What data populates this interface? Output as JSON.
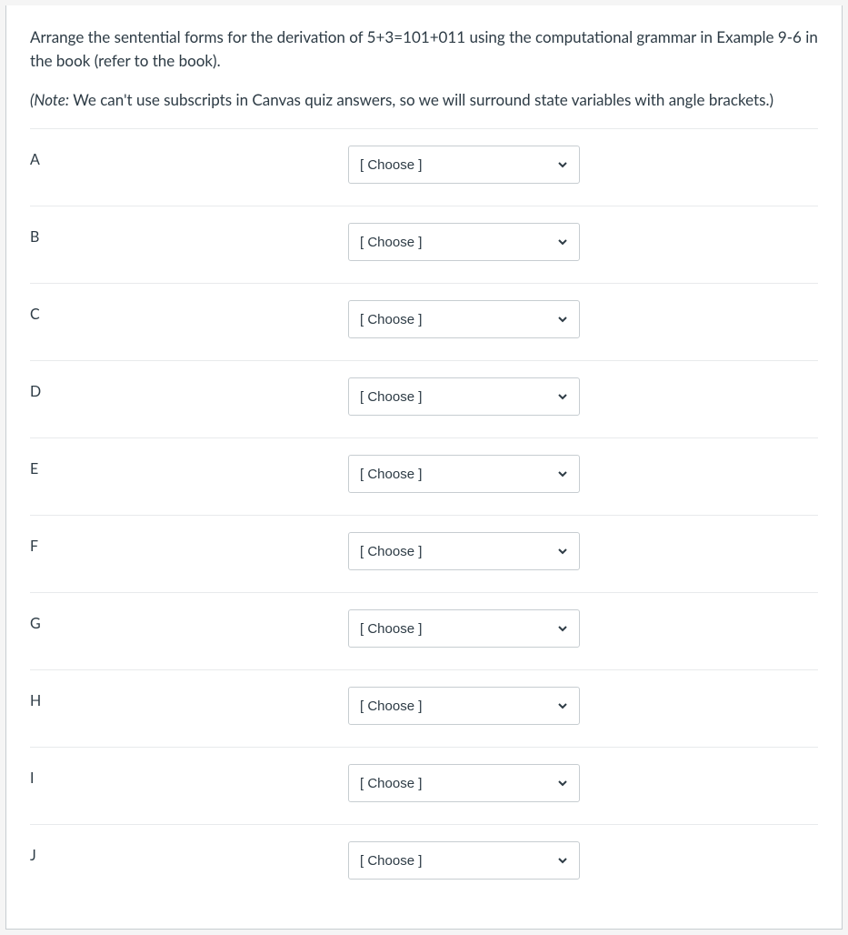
{
  "question": {
    "prompt_line1": "Arrange the sentential forms for the derivation of 5+3=101+011 using the computational grammar in Example 9-6 in the book (refer to the book).",
    "note_prefix": "(Note:",
    "note_body": " We can't use subscripts in Canvas quiz answers, so we will surround state variables with angle brackets.)"
  },
  "select_placeholder": "[ Choose ]",
  "rows": [
    {
      "label": "A"
    },
    {
      "label": "B"
    },
    {
      "label": "C"
    },
    {
      "label": "D"
    },
    {
      "label": "E"
    },
    {
      "label": "F"
    },
    {
      "label": "G"
    },
    {
      "label": "H"
    },
    {
      "label": "I"
    },
    {
      "label": "J"
    }
  ]
}
